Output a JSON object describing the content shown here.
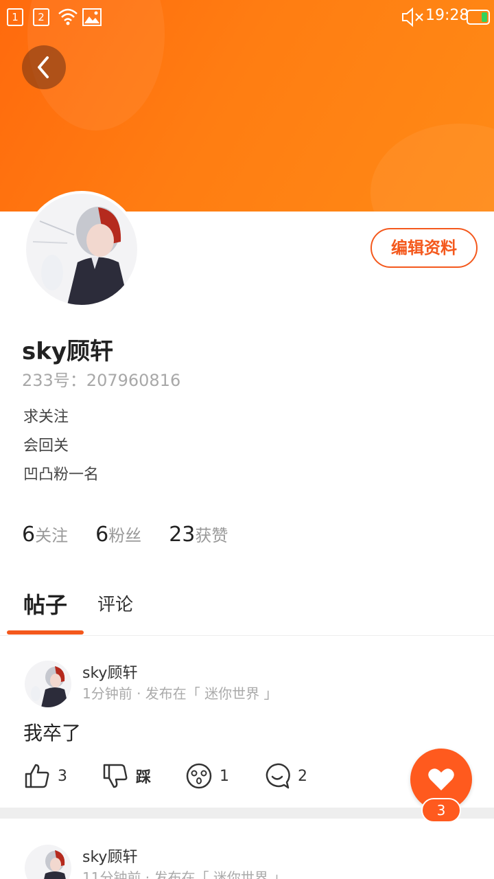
{
  "status_bar": {
    "sim1": "1",
    "sim2": "2",
    "time": "19:28",
    "icons": [
      "sim1-icon",
      "sim2-icon",
      "wifi-icon",
      "image-icon",
      "mute-icon",
      "battery-icon"
    ]
  },
  "colors": {
    "banner": "#ff7a12",
    "accent": "#f4581c",
    "battery": "#34d35a"
  },
  "profile": {
    "edit_label": "编辑资料",
    "username": "sky顾轩",
    "uid": "233号：207960816",
    "bio": [
      "求关注",
      "会回关",
      "凹凸粉一名"
    ]
  },
  "stats": [
    {
      "value": "6",
      "label": "关注"
    },
    {
      "value": "6",
      "label": "粉丝"
    },
    {
      "value": "23",
      "label": "获赞"
    }
  ],
  "tabs": {
    "posts": "帖子",
    "comments": "评论"
  },
  "posts": [
    {
      "author": "sky顾轩",
      "meta": "1分钟前 · 发布在「 迷你世界 」",
      "content": "我卒了",
      "likes": "3",
      "dislike_label": "踩",
      "reactions": "1",
      "comments": "2"
    },
    {
      "author": "sky顾轩",
      "meta": "11分钟前 · 发布在「 迷你世界 」"
    }
  ],
  "fab": {
    "count": "3"
  }
}
